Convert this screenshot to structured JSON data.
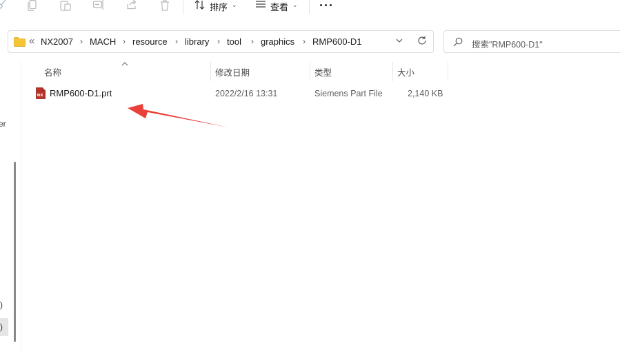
{
  "toolbar": {
    "sort_label": "排序",
    "view_label": "查看",
    "more_label": "···",
    "icons": [
      "cut-icon",
      "copy-icon",
      "paste-icon",
      "rename-icon",
      "share-icon",
      "delete-icon",
      "sort-icon",
      "view-icon"
    ]
  },
  "address": {
    "overflow_label": "«",
    "crumbs": [
      "NX2007",
      "MACH",
      "resource",
      "library",
      "tool",
      "graphics",
      "RMP600-D1"
    ]
  },
  "search": {
    "placeholder": "搜索\"RMP600-D1\""
  },
  "nav_fragments": {
    "frag1": "er",
    "frag2": ")",
    "frag3": ")"
  },
  "columns": {
    "name": "名称",
    "modified": "修改日期",
    "type": "类型",
    "size": "大小"
  },
  "files": [
    {
      "name": "RMP600-D1.prt",
      "modified": "2022/2/16 13:31",
      "type": "Siemens Part File",
      "size": "2,140 KB",
      "icon_badge": "NX"
    }
  ],
  "colors": {
    "accent_red": "#e8413a",
    "folder_yellow": "#f2c230",
    "nx_icon": "#b83228"
  }
}
